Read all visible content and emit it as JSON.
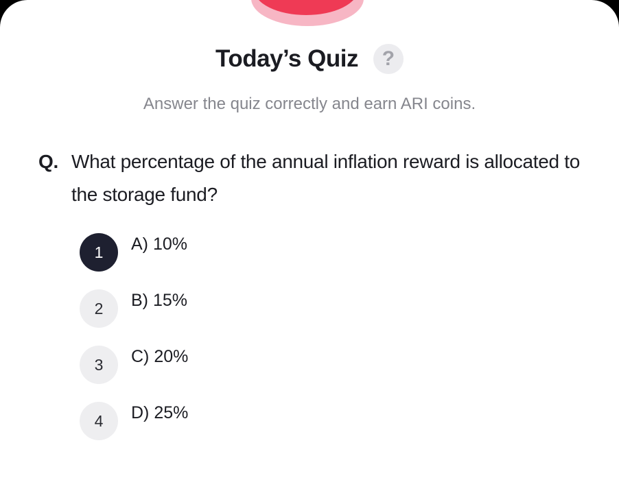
{
  "header": {
    "title": "Today’s Quiz",
    "help_icon_glyph": "?",
    "subtitle": "Answer the quiz correctly and earn ARI coins."
  },
  "question": {
    "prefix": "Q.",
    "text": "What percentage of the annual inflation reward is allocated to the storage fund?"
  },
  "options": [
    {
      "number": "1",
      "label": "A) 10%",
      "selected": true
    },
    {
      "number": "2",
      "label": "B) 15%",
      "selected": false
    },
    {
      "number": "3",
      "label": "C) 20%",
      "selected": false
    },
    {
      "number": "4",
      "label": "D) 25%",
      "selected": false
    }
  ],
  "colors": {
    "background": "#000000",
    "sheet": "#ffffff",
    "title_text": "#1b1c22",
    "subtitle_text": "#85868d",
    "selected_badge": "#1e2030",
    "unselected_badge": "#eeeef0",
    "hero_red": "#ef3a55",
    "hero_pink": "#f7b6c4"
  },
  "icons": {
    "help": "question-mark-icon",
    "hero": "coin-illustration"
  }
}
